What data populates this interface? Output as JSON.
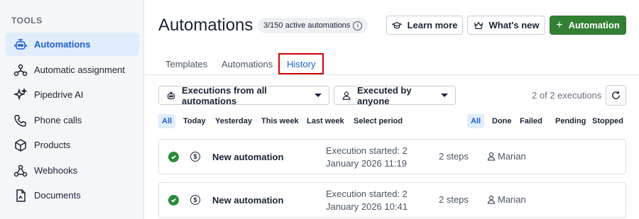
{
  "sidebar": {
    "heading": "TOOLS",
    "items": [
      {
        "label": "Automations",
        "icon": "robot-icon",
        "active": true
      },
      {
        "label": "Automatic assignment",
        "icon": "assignment-icon",
        "active": false
      },
      {
        "label": "Pipedrive AI",
        "icon": "sparkle-icon",
        "active": false
      },
      {
        "label": "Phone calls",
        "icon": "phone-icon",
        "active": false
      },
      {
        "label": "Products",
        "icon": "box-icon",
        "active": false
      },
      {
        "label": "Webhooks",
        "icon": "webhook-icon",
        "active": false
      },
      {
        "label": "Documents",
        "icon": "document-icon",
        "active": false
      }
    ]
  },
  "header": {
    "title": "Automations",
    "count_badge": "3/150 active automations",
    "info_icon": "info-icon",
    "learn_more": "Learn more",
    "whats_new": "What's new",
    "add_automation": "Automation"
  },
  "tabs": [
    {
      "label": "Templates",
      "active": false
    },
    {
      "label": "Automations",
      "active": false
    },
    {
      "label": "History",
      "active": true
    }
  ],
  "filters": {
    "automation_filter": "Executions from all automations",
    "executor_filter": "Executed by anyone",
    "execution_count": "2 of 2 executions",
    "period_chips": [
      "All",
      "Today",
      "Yesterday",
      "This week",
      "Last week",
      "Select period"
    ],
    "period_selected": "All",
    "status_chips": [
      "All",
      "Done",
      "Failed",
      "Pending",
      "Stopped"
    ],
    "status_selected": "All"
  },
  "executions": [
    {
      "name": "New automation",
      "started": "Execution started: 2 January 2026 11:19",
      "steps": "2 steps",
      "user": "Marian",
      "status": "done"
    },
    {
      "name": "New automation",
      "started": "Execution started: 2 January 2026 10:41",
      "steps": "2 steps",
      "user": "Marian",
      "status": "done"
    }
  ],
  "colors": {
    "accent_blue": "#1e5fd0",
    "primary_green": "#338035",
    "active_bg": "#e1edfc",
    "highlight_red": "#d40000"
  }
}
